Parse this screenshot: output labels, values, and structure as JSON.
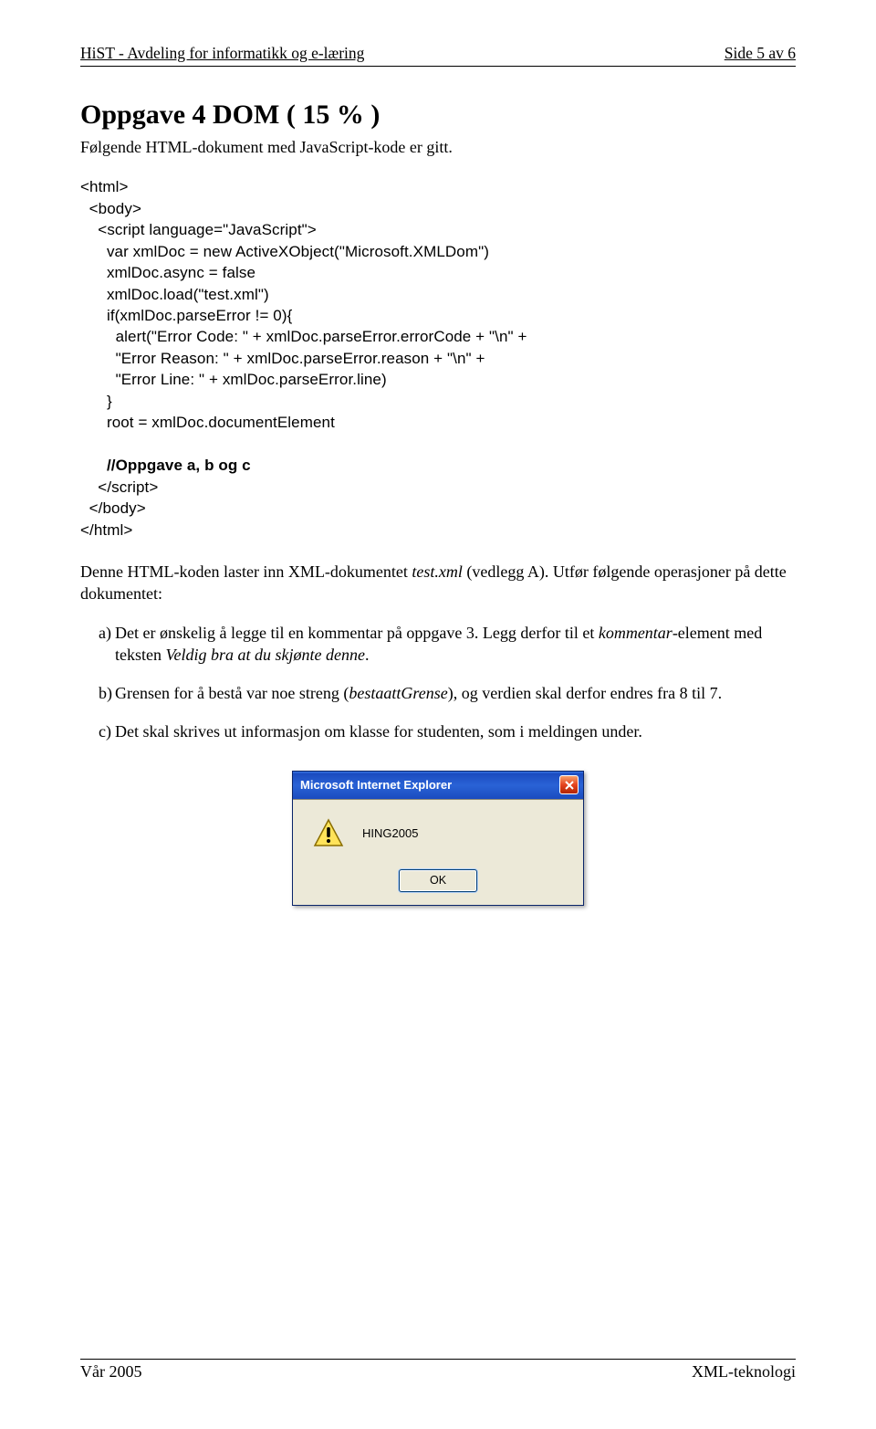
{
  "header": {
    "left": "HiST - Avdeling for informatikk og e-læring",
    "right": "Side 5 av 6"
  },
  "title": "Oppgave 4 DOM ( 15 % )",
  "intro": "Følgende HTML-dokument med JavaScript-kode er gitt.",
  "code_prefix": "<html>\n  <body>\n    <script language=\"JavaScript\">\n      var xmlDoc = new ActiveXObject(\"Microsoft.XMLDom\")\n      xmlDoc.async = false\n      xmlDoc.load(\"test.xml\")\n      if(xmlDoc.parseError != 0){\n        alert(\"Error Code: \" + xmlDoc.parseError.errorCode + \"\\n\" +\n        \"Error Reason: \" + xmlDoc.parseError.reason + \"\\n\" +\n        \"Error Line: \" + xmlDoc.parseError.line)\n      }\n      root = xmlDoc.documentElement\n\n      ",
  "code_bold": "//Oppgave a, b og c",
  "code_suffix": "\n    </script>\n  </body>\n</html>",
  "para_prefix": "Denne HTML-koden laster inn XML-dokumentet ",
  "para_italic1": "test.xml",
  "para_mid": " (vedlegg A). Utfør følgende operasjoner på dette dokumentet:",
  "q_a_marker": "a)",
  "q_a_1": "Det er ønskelig å legge til en kommentar på oppgave 3. Legg derfor til et ",
  "q_a_italic1": "kommentar",
  "q_a_2": "-element med teksten ",
  "q_a_italic2": "Veldig bra at du skjønte denne",
  "q_a_3": ".",
  "q_b_marker": "b)",
  "q_b_1": "Grensen for å bestå var noe streng (",
  "q_b_italic": "bestaattGrense",
  "q_b_2": "), og verdien skal derfor endres fra 8 til 7.",
  "q_c_marker": "c)",
  "q_c": "Det skal skrives ut informasjon om klasse for studenten, som i meldingen under.",
  "dialog": {
    "title": "Microsoft Internet Explorer",
    "message": "HING2005",
    "ok": "OK",
    "close": "X"
  },
  "footer": {
    "left": "Vår 2005",
    "right": "XML-teknologi"
  }
}
